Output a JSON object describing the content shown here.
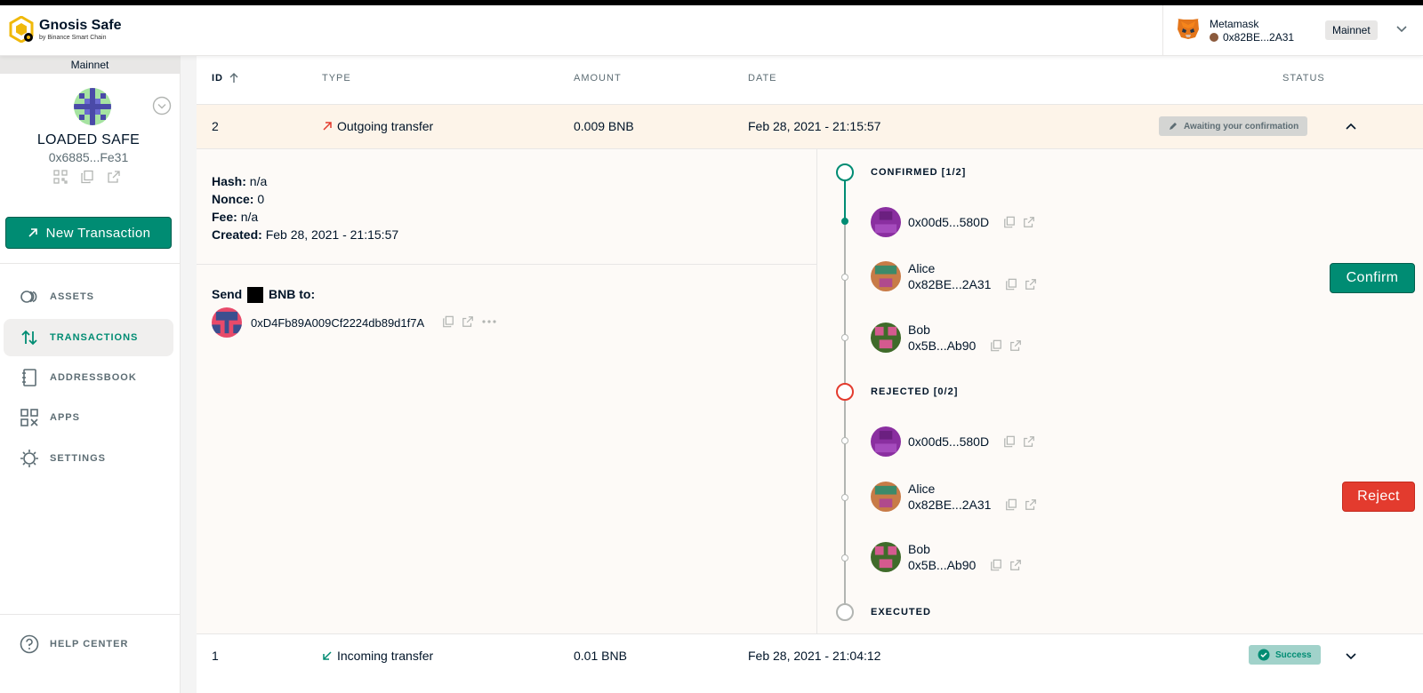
{
  "header": {
    "logo_title": "Gnosis Safe",
    "logo_subtitle": "by Binance Smart Chain",
    "wallet_name": "Metamask",
    "wallet_address": "0x82BE...2A31",
    "network_pill": "Mainnet"
  },
  "sidebar": {
    "network": "Mainnet",
    "safe_name": "LOADED SAFE",
    "safe_address": "0x6885...Fe31",
    "new_tx_label": "New Transaction",
    "nav": [
      {
        "label": "ASSETS",
        "icon": "assets-icon"
      },
      {
        "label": "TRANSACTIONS",
        "icon": "transactions-icon"
      },
      {
        "label": "ADDRESSBOOK",
        "icon": "addressbook-icon"
      },
      {
        "label": "APPS",
        "icon": "apps-icon"
      },
      {
        "label": "SETTINGS",
        "icon": "settings-icon"
      }
    ],
    "help": "HELP CENTER"
  },
  "table": {
    "columns": [
      "ID",
      "TYPE",
      "AMOUNT",
      "DATE",
      "STATUS"
    ],
    "rows": [
      {
        "id": "2",
        "type": "Outgoing transfer",
        "amount": "0.009 BNB",
        "date": "Feb 28, 2021 - 21:15:57",
        "status": "Awaiting your confirmation"
      },
      {
        "id": "1",
        "type": "Incoming transfer",
        "amount": "0.01 BNB",
        "date": "Feb 28, 2021 - 21:04:12",
        "status": "Success"
      }
    ]
  },
  "details": {
    "hash_label": "Hash:",
    "hash": "n/a",
    "nonce_label": "Nonce:",
    "nonce": "0",
    "fee_label": "Fee:",
    "fee": "n/a",
    "created_label": "Created:",
    "created": "Feb 28, 2021 - 21:15:57",
    "send_prefix": "Send",
    "send_suffix": "BNB to:",
    "recipient": "0xD4Fb89A009Cf2224db89d1f7A"
  },
  "timeline": {
    "confirmed_label": "CONFIRMED [1/2]",
    "rejected_label": "REJECTED [0/2]",
    "executed_label": "EXECUTED",
    "confirmed_owners": [
      {
        "name": "",
        "address": "0x00d5...580D"
      },
      {
        "name": "Alice",
        "address": "0x82BE...2A31"
      },
      {
        "name": "Bob",
        "address": "0x5B...Ab90"
      }
    ],
    "rejected_owners": [
      {
        "name": "",
        "address": "0x00d5...580D"
      },
      {
        "name": "Alice",
        "address": "0x82BE...2A31"
      },
      {
        "name": "Bob",
        "address": "0x5B...Ab90"
      }
    ],
    "confirm_button": "Confirm",
    "reject_button": "Reject"
  },
  "colors": {
    "primary": "#008c73",
    "reject": "#e33b2e",
    "pending_bg": "#fdf4e9"
  }
}
